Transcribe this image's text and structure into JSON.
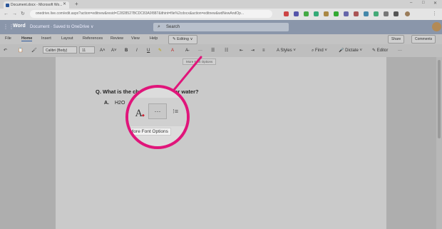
{
  "browser": {
    "tab_title": "Document.docx - Microsoft Wo...",
    "new_tab": "+",
    "url": "onedrive.live.com/edit.aspx?action=editnew&resid=C2828527BCDC83A9!887&ithint=file%2cdocx&action=editnew&wdNewAndOp...",
    "window_controls": [
      "–",
      "□",
      "✕"
    ]
  },
  "app": {
    "name": "Word",
    "doc_title": "Document · Saved to OneDrive ∨",
    "search_placeholder": "Search"
  },
  "menu": {
    "items": [
      "File",
      "Home",
      "Insert",
      "Layout",
      "References",
      "Review",
      "View",
      "Help"
    ],
    "editing": "Editing ∨",
    "share": "Share",
    "comments": "Comments"
  },
  "toolbar": {
    "font_name": "Calibri (Body)",
    "font_size": "11",
    "bold": "B",
    "italic": "I",
    "underline": "U",
    "more": "···",
    "styles": "Styles",
    "find": "Find",
    "dictate": "Dictate",
    "editor": "Editor",
    "tooltip": "More Font Options"
  },
  "document": {
    "question": "Q.  What is the ch",
    "question_tail": "or water?",
    "answer_label": "A.",
    "answer_text": "H2O"
  },
  "zoom": {
    "more_label": "···",
    "tooltip": "More Font Options"
  },
  "colors": {
    "highlight_ring": "#e0157a",
    "word_bar": "#8a96aa"
  }
}
